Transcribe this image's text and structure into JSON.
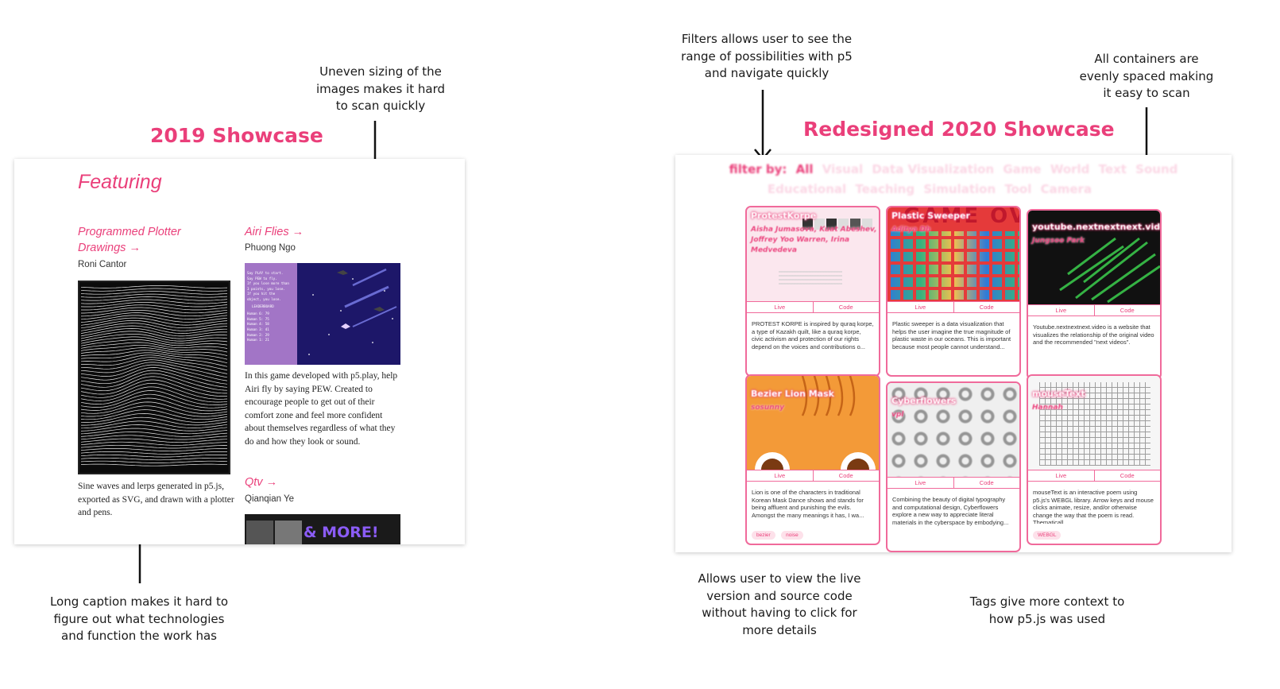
{
  "annotations": {
    "uneven_sizing": [
      "Uneven sizing of the",
      "images makes it hard",
      "to scan quickly"
    ],
    "long_caption": [
      "Long caption makes it hard to",
      "figure out what technologies",
      "and function the work has"
    ],
    "filters": [
      "Filters allows user to see the",
      "range of possibilities with p5",
      "and navigate quickly"
    ],
    "evenly_spaced": [
      "All containers are",
      "evenly spaced making",
      "it easy to scan"
    ],
    "live_code": [
      "Allows user to view the live",
      "version and source code",
      "without having to click for",
      "more details"
    ],
    "tags": [
      "Tags give more context to",
      "how p5.js was used"
    ]
  },
  "showcase_2019": {
    "title": "2019 Showcase",
    "featuring": "Featuring",
    "works": [
      {
        "title": "Programmed Plotter Drawings →",
        "author": "Roni Cantor",
        "caption": "Sine waves and lerps generated in p5.js, exported as SVG, and drawn with a plotter and pens."
      },
      {
        "title": "Airi Flies →",
        "author": "Phuong Ngo",
        "caption": "In this game developed with p5.play, help Airi fly by saying PEW. Created to encourage people to get out of their comfort zone and feel more confident about themselves regardless of what they do and how they look or sound.",
        "game_lines": [
          "Say PLAY to start.",
          "Say PEW to fly.",
          "If you lose more than",
          "3 points, you lose.",
          "If you hit the",
          "object, you lose.",
          "LEADERBOARD",
          "Human 6: 79",
          "Human 5: 75",
          "Human 4: 58",
          "Human 3: 41",
          "Human 2: 29",
          "Human 1: 21"
        ]
      },
      {
        "title": "Qtv →",
        "author": "Qianqian Ye",
        "thumb_text": "& MORE!"
      }
    ]
  },
  "showcase_2020": {
    "title": "Redesigned 2020 Showcase",
    "filter_label": "filter by:",
    "filters_row1": [
      "All",
      "Visual",
      "Data Visualization",
      "Game",
      "World",
      "Text",
      "Sound"
    ],
    "filters_row2": [
      "Educational",
      "Teaching",
      "Simulation",
      "Tool",
      "Camera"
    ],
    "live_label": "Live",
    "code_label": "Code",
    "cards": [
      {
        "title": "ProtestKorpe",
        "author": "Aisha Jumasova, Kuat Abeshev, Joffrey Yoo Warren, Irina Medvedeva",
        "desc": "PROTEST KORPE is inspired by quraq korpe, a type of Kazakh quilt, like a quraq korpe, civic activism and protection of our rights depend on the voices and contributions o...",
        "tags": []
      },
      {
        "title": "Plastic Sweeper",
        "author": "Aditya Dh",
        "desc": "Plastic sweeper is a data visualization that helps the user imagine the true magnitude of plastic waste in our oceans. This is important because most people cannot understand...",
        "tags": []
      },
      {
        "title": "youtube.nextnextnext.video",
        "author": "Jungsoo Park",
        "desc": "Youtube.nextnextnext.video is a website that visualizes the relationship of the original video and the recommended \"next videos\".",
        "tags": []
      },
      {
        "title": "Bezier Lion Mask",
        "author": "sosunny",
        "desc": "Lion is one of the characters in traditional Korean Mask Dance shows and stands for being affluent and punishing the evils. Amongst the many meanings it has, I wa...",
        "tags": [
          "bezier",
          "noise"
        ]
      },
      {
        "title": "Cyberflowers",
        "author": "vpl",
        "desc": "Combining the beauty of digital typography and computational design, Cyberflowers explore a new way to appreciate literal materials in the cyberspace by embodying...",
        "tags": []
      },
      {
        "title": "mouseText",
        "author": "Hannah",
        "desc": "mouseText is an interactive poem using p5.js's WEBGL library. Arrow keys and mouse clicks animate, resize, and/or otherwise change the way that the poem is read. Thematicall...",
        "tags": [
          "WEBGL"
        ]
      }
    ],
    "colors": {
      "accent": "#ea3f7a",
      "border": "#f06a9b",
      "tag_bg": "#fde1ea"
    }
  }
}
